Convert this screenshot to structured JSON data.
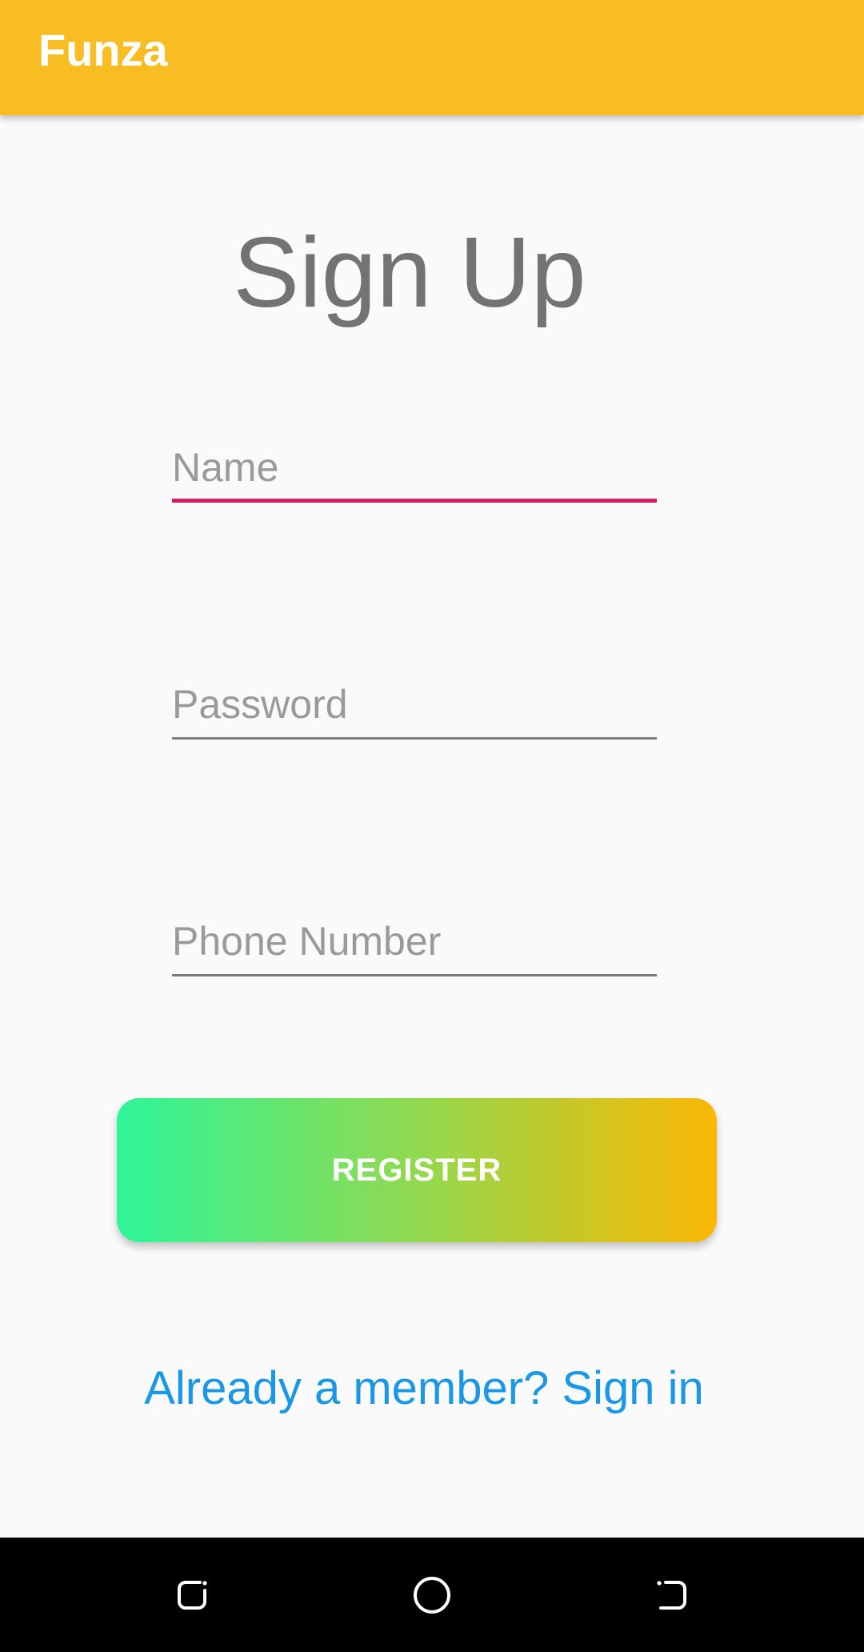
{
  "app_bar": {
    "title": "Funza",
    "color": "#f9bd24"
  },
  "page": {
    "title": "Sign Up"
  },
  "form": {
    "name_placeholder": "Name",
    "password_placeholder": "Password",
    "phone_placeholder": "Phone Number",
    "focused_field": "name",
    "focus_color": "#d81b60"
  },
  "register_button": {
    "label": "REGISTER",
    "gradient_start": "#2ef598",
    "gradient_end": "#fab703"
  },
  "signin_link": {
    "text": "Already a member? Sign in",
    "color": "#1a98e6"
  },
  "nav_bar": {
    "buttons": [
      {
        "name": "recent-apps",
        "icon": "recent-apps-icon"
      },
      {
        "name": "home",
        "icon": "home-circle-icon"
      },
      {
        "name": "back",
        "icon": "back-icon"
      }
    ]
  }
}
